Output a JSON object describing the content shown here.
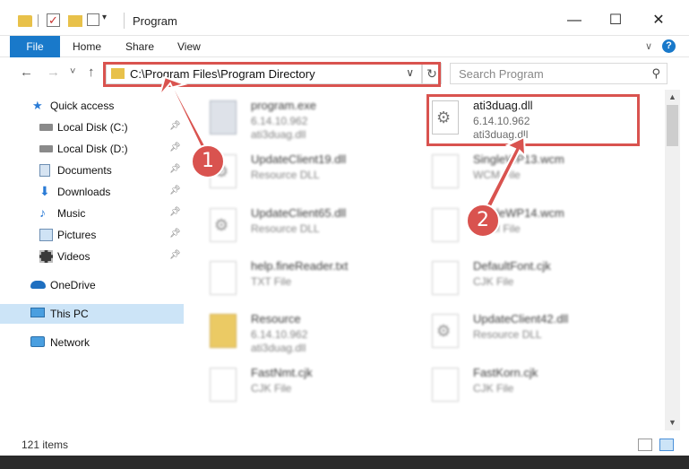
{
  "window": {
    "title": "Program",
    "minimize": "—",
    "maximize": "☐",
    "close": "✕"
  },
  "ribbon": {
    "file": "File",
    "home": "Home",
    "share": "Share",
    "view": "View",
    "help": "?"
  },
  "nav": {
    "back": "←",
    "forward": "→",
    "recent": "˅",
    "up": "↑",
    "address": "C:\\Program Files\\Program Directory",
    "refresh": "↻",
    "search_placeholder": "Search Program"
  },
  "sidebar": {
    "items": [
      {
        "label": "Quick access",
        "icon": "star-icon",
        "pinned": false
      },
      {
        "label": "Local Disk (C:)",
        "icon": "drive-icon",
        "pinned": true
      },
      {
        "label": "Local Disk (D:)",
        "icon": "drive-icon",
        "pinned": true
      },
      {
        "label": "Documents",
        "icon": "documents-icon",
        "pinned": true
      },
      {
        "label": "Downloads",
        "icon": "download-icon",
        "pinned": true
      },
      {
        "label": "Music",
        "icon": "music-icon",
        "pinned": true
      },
      {
        "label": "Pictures",
        "icon": "pictures-icon",
        "pinned": true
      },
      {
        "label": "Videos",
        "icon": "videos-icon",
        "pinned": true
      },
      {
        "label": "OneDrive",
        "icon": "cloud-icon",
        "pinned": false
      },
      {
        "label": "This PC",
        "icon": "computer-icon",
        "pinned": false,
        "selected": true
      },
      {
        "label": "Network",
        "icon": "network-icon",
        "pinned": false
      }
    ]
  },
  "files": [
    {
      "name": "program.exe",
      "line2": "6.14.10.962",
      "line3": "ati3duag.dll",
      "icon": "exe"
    },
    {
      "name": "ati3duag.dll",
      "line2": "6.14.10.962",
      "line3": "ati3duag.dll",
      "icon": "gear",
      "highlighted": true
    },
    {
      "name": "UpdateClient19.dll",
      "line2": "Resource DLL",
      "line3": "",
      "icon": "gear"
    },
    {
      "name": "SingleWP13.wcm",
      "line2": "WCM File",
      "line3": "",
      "icon": "file"
    },
    {
      "name": "UpdateClient65.dll",
      "line2": "Resource DLL",
      "line3": "",
      "icon": "gear"
    },
    {
      "name": "SingleWP14.wcm",
      "line2": "WCM File",
      "line3": "",
      "icon": "file"
    },
    {
      "name": "help.fineReader.txt",
      "line2": "TXT File",
      "line3": "",
      "icon": "file"
    },
    {
      "name": "DefaultFont.cjk",
      "line2": "CJK File",
      "line3": "",
      "icon": "file"
    },
    {
      "name": "Resource",
      "line2": "6.14.10.962",
      "line3": "ati3duag.dll",
      "icon": "folder"
    },
    {
      "name": "UpdateClient42.dll",
      "line2": "Resource DLL",
      "line3": "",
      "icon": "gear"
    },
    {
      "name": "FastNmt.cjk",
      "line2": "CJK File",
      "line3": "",
      "icon": "file"
    },
    {
      "name": "FastKorn.cjk",
      "line2": "CJK File",
      "line3": "",
      "icon": "file"
    }
  ],
  "callouts": {
    "one": "1",
    "two": "2"
  },
  "status": {
    "count": "121 items"
  },
  "colors": {
    "accent": "#1979ca",
    "highlight": "#d9534f",
    "folder": "#e8c14a"
  }
}
